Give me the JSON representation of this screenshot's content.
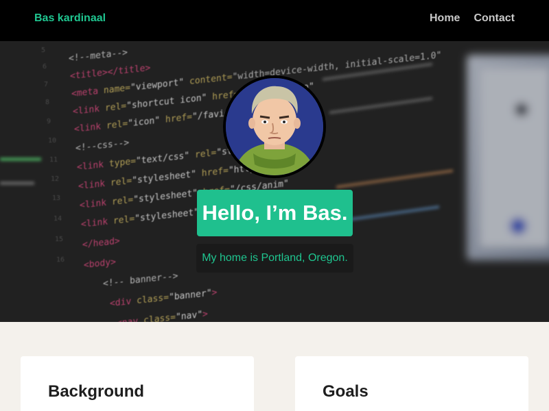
{
  "navbar": {
    "brand": "Bas kardinaal",
    "links": [
      {
        "label": "Home"
      },
      {
        "label": "Contact"
      }
    ]
  },
  "hero": {
    "headline": "Hello, I’m Bas.",
    "subline": "My home is Portland, Oregon.",
    "avatar_alt": "avatar"
  },
  "sections": [
    {
      "title": "Background"
    },
    {
      "title": "Goals"
    }
  ],
  "colors": {
    "accent": "#1fc690",
    "navbar_bg": "#000000",
    "page_bg": "#f4f1ec",
    "card_bg": "#ffffff"
  }
}
